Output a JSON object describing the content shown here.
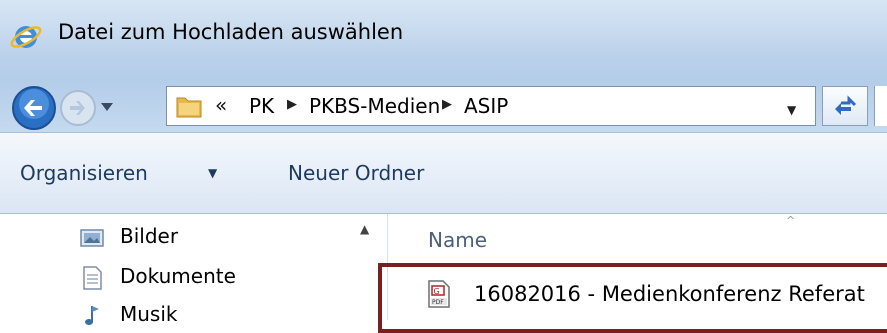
{
  "window": {
    "title": "Datei zum Hochladen auswählen",
    "title_icon": "internet-explorer-icon"
  },
  "navigation": {
    "back_icon": "back-arrow-icon",
    "forward_icon": "forward-arrow-icon",
    "recent_icon": "recent-pages-dropdown-icon",
    "address": {
      "folder_icon": "folder-icon",
      "overflow": "«",
      "separator": "▶",
      "crumbs": [
        "PK",
        "PKBS-Medien",
        "ASIP"
      ],
      "dropdown": "▼"
    },
    "refresh_icon": "refresh-icon"
  },
  "commandbar": {
    "organize_label": "Organisieren",
    "organize_arrow": "▼",
    "new_folder_label": "Neuer Ordner"
  },
  "navpane": {
    "scroll_up": "▲",
    "items": [
      {
        "label": "Bilder",
        "icon": "pictures-library-icon"
      },
      {
        "label": "Dokumente",
        "icon": "documents-library-icon"
      },
      {
        "label": "Musik",
        "icon": "music-library-icon"
      }
    ]
  },
  "filelist": {
    "sort_indicator": "^",
    "column_name": "Name",
    "files": [
      {
        "name": "16082016 - Medienkonferenz Referat",
        "icon": "pdf-file-icon"
      }
    ]
  },
  "colors": {
    "titlebar": "#cadcef",
    "highlight_border": "#7a1f1f",
    "command_text": "#1e3a5f"
  }
}
